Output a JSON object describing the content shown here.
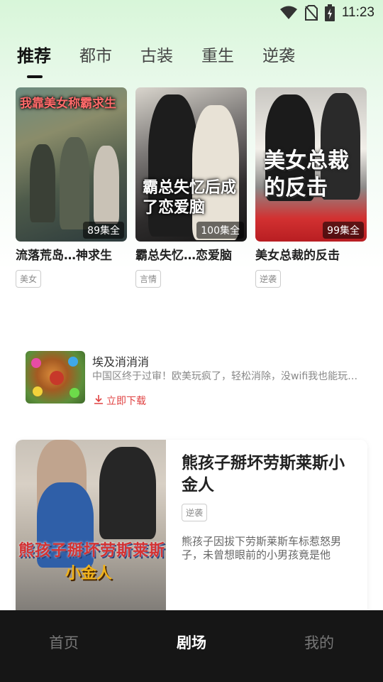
{
  "status_bar": {
    "time": "11:23",
    "icons": [
      "wifi-icon",
      "no-sim-icon",
      "battery-charging-icon"
    ]
  },
  "tabs": [
    {
      "label": "推荐",
      "active": true
    },
    {
      "label": "都市",
      "active": false
    },
    {
      "label": "古装",
      "active": false
    },
    {
      "label": "重生",
      "active": false
    },
    {
      "label": "逆袭",
      "active": false
    }
  ],
  "dramas": [
    {
      "poster_text": "我靠美女称霸求生",
      "episodes": "89集全",
      "title": "流落荒岛…神求生",
      "tag": "美女"
    },
    {
      "poster_text": "霸总失忆后成了恋爱脑",
      "episodes": "100集全",
      "title": "霸总失忆…恋爱脑",
      "tag": "言情"
    },
    {
      "poster_text": "美女总裁的反击",
      "episodes": "99集全",
      "title": "美女总裁的反击",
      "tag": "逆袭"
    }
  ],
  "ad": {
    "title": "埃及消消消",
    "description": "中国区终于过审！欧美玩疯了，轻松消除，没wifi我也能玩…",
    "download_label": "立即下载"
  },
  "featured": {
    "poster_text_line1": "熊孩子掰坏劳斯莱斯",
    "poster_text_line2": "小金人",
    "title": "熊孩子掰坏劳斯莱斯小金人",
    "tag": "逆袭",
    "description": "熊孩子因拔下劳斯莱斯车标惹怒男子，未曾想眼前的小男孩竟是他"
  },
  "bottom_nav": [
    {
      "label": "首页",
      "active": false
    },
    {
      "label": "剧场",
      "active": true
    },
    {
      "label": "我的",
      "active": false
    }
  ],
  "colors": {
    "accent_red": "#e04242",
    "nav_background": "#161616",
    "top_gradient": "#d8f6d9"
  }
}
